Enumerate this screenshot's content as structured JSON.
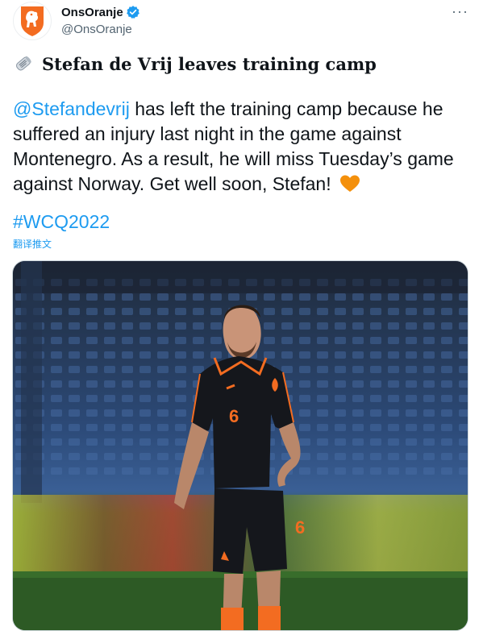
{
  "tweet": {
    "author": {
      "display_name": "OnsOranje",
      "handle": "@OnsOranje",
      "verified": true,
      "avatar_icon": "knvb-lion-crest-icon"
    },
    "more_label": "···",
    "headline": {
      "icon": "rolled-newspaper-icon",
      "text": "Stefan de Vrij leaves training camp"
    },
    "body": {
      "mention": "@Stefandevrij",
      "text": " has left the training camp because he suffered an injury last night in the game against Montenegro. As a result, he will miss Tuesday’s game against Norway. Get well soon, Stefan! ",
      "emoji_icon": "orange-heart-icon"
    },
    "hashtag": "#WCQ2022",
    "translate_label": "翻译推文",
    "media": {
      "type": "photo",
      "jersey_number": "6"
    }
  },
  "colors": {
    "link": "#1d9bf0",
    "orange": "#f28c1c",
    "verified": "#1d9bf0",
    "secondary_text": "#536471"
  }
}
